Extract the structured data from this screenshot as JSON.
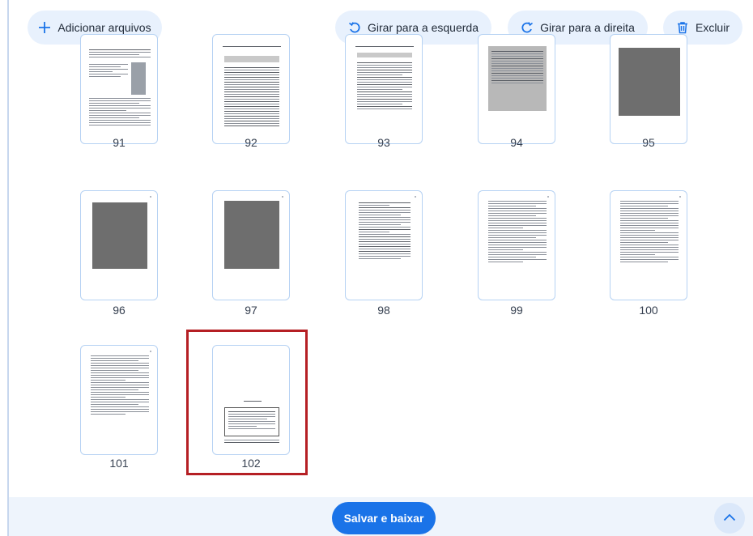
{
  "toolbar": {
    "add_files": "Adicionar arquivos",
    "rotate_left": "Girar para a esquerda",
    "rotate_right": "Girar para a direita",
    "delete": "Excluir"
  },
  "pages": [
    {
      "number": "91",
      "selected": false
    },
    {
      "number": "92",
      "selected": false
    },
    {
      "number": "93",
      "selected": false
    },
    {
      "number": "94",
      "selected": false
    },
    {
      "number": "95",
      "selected": false
    },
    {
      "number": "96",
      "selected": false
    },
    {
      "number": "97",
      "selected": false
    },
    {
      "number": "98",
      "selected": false
    },
    {
      "number": "99",
      "selected": false
    },
    {
      "number": "100",
      "selected": false
    },
    {
      "number": "101",
      "selected": false
    },
    {
      "number": "102",
      "selected": true
    }
  ],
  "footer": {
    "save_label": "Salvar e baixar"
  },
  "colors": {
    "accent": "#1a73e8",
    "button_bg": "#e8f1fd",
    "selection": "#b51f24",
    "thumb_border": "#b6d2f3"
  }
}
